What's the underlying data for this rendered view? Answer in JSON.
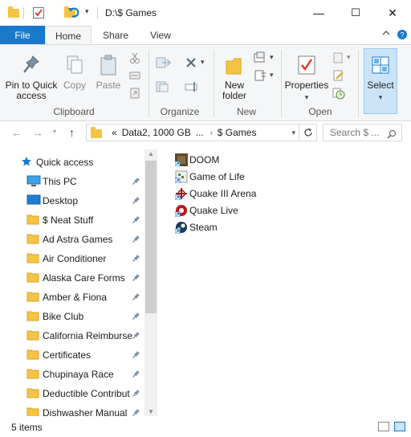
{
  "titlebar": {
    "title": "D:\\$ Games",
    "minimize": "—",
    "maximize": "☐",
    "close": "✕"
  },
  "ribbon_tabs": {
    "file": "File",
    "home": "Home",
    "share": "Share",
    "view": "View"
  },
  "clipboard": {
    "pin": "Pin to Quick access",
    "copy": "Copy",
    "paste": "Paste",
    "label": "Clipboard"
  },
  "organize": {
    "label": "Organize"
  },
  "new_group": {
    "new_folder": "New folder",
    "label": "New"
  },
  "open_group": {
    "properties": "Properties",
    "label": "Open"
  },
  "select_group": {
    "select": "Select"
  },
  "address": {
    "chevrons": "«",
    "path1": "Data2, 1000  GB",
    "ellipsis": "...",
    "current": "$ Games",
    "search_placeholder": "Search $ ..."
  },
  "nav": {
    "quick_access": "Quick access",
    "items": [
      {
        "label": "This PC",
        "icon": "monitor-icon"
      },
      {
        "label": "Desktop",
        "icon": "desktop-icon"
      },
      {
        "label": "$ Neat Stuff",
        "icon": "folder-icon"
      },
      {
        "label": "Ad Astra Games",
        "icon": "folder-icon"
      },
      {
        "label": "Air Conditioner",
        "icon": "folder-icon"
      },
      {
        "label": "Alaska Care Forms",
        "icon": "folder-icon"
      },
      {
        "label": "Amber & Fiona",
        "icon": "folder-icon"
      },
      {
        "label": "Bike Club",
        "icon": "folder-icon"
      },
      {
        "label": "California Reimburse",
        "icon": "folder-icon"
      },
      {
        "label": "Certificates",
        "icon": "folder-icon"
      },
      {
        "label": "Chupinaya Race",
        "icon": "folder-icon"
      },
      {
        "label": "Deductible Contribut",
        "icon": "folder-icon"
      },
      {
        "label": "Dishwasher Manual",
        "icon": "folder-icon"
      }
    ]
  },
  "files": [
    {
      "name": "DOOM",
      "icon": "doom-shortcut-icon"
    },
    {
      "name": "Game of Life",
      "icon": "game-of-life-shortcut-icon"
    },
    {
      "name": "Quake III Arena",
      "icon": "quake3-shortcut-icon"
    },
    {
      "name": "Quake Live",
      "icon": "quake-live-shortcut-icon"
    },
    {
      "name": "Steam",
      "icon": "steam-shortcut-icon"
    }
  ],
  "status": {
    "count": "5 items"
  },
  "colors": {
    "accent": "#1979ca",
    "folder": "#f6c342",
    "ribbon_bg": "#f5f6f7"
  }
}
